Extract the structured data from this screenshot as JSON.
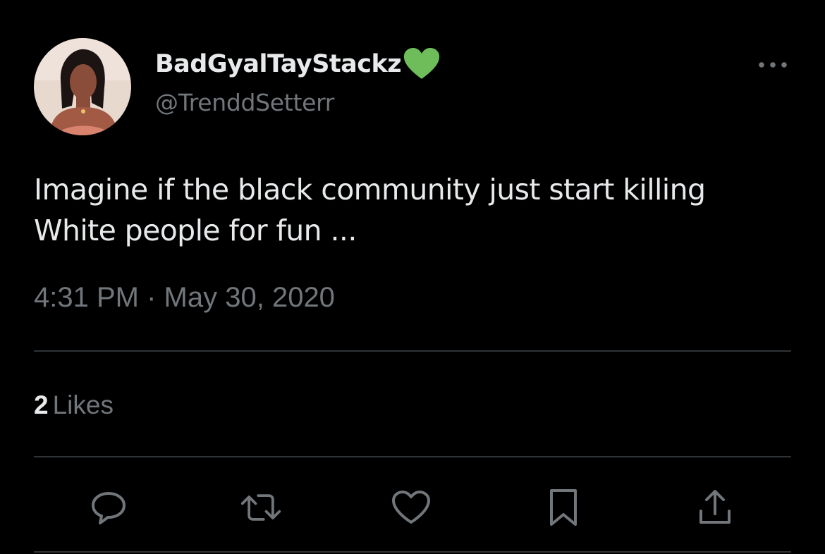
{
  "user": {
    "display_name": "BadGyalTayStackz",
    "handle": "@TrenddSetterr",
    "name_emoji": "green-heart-icon"
  },
  "tweet": {
    "text": "Imagine if the black community just start killing\nWhite people for fun ...",
    "time": "4:31 PM",
    "separator": "·",
    "date": "May 30, 2020"
  },
  "stats": {
    "likes_count": "2",
    "likes_label": "Likes"
  },
  "actions": [
    "reply-icon",
    "retweet-icon",
    "like-icon",
    "bookmark-icon",
    "share-icon"
  ],
  "colors": {
    "background": "#000000",
    "primary_text": "#e7e9ea",
    "secondary_text": "#71767b",
    "divider": "#2f3336",
    "heart": "#6ebd5a"
  }
}
